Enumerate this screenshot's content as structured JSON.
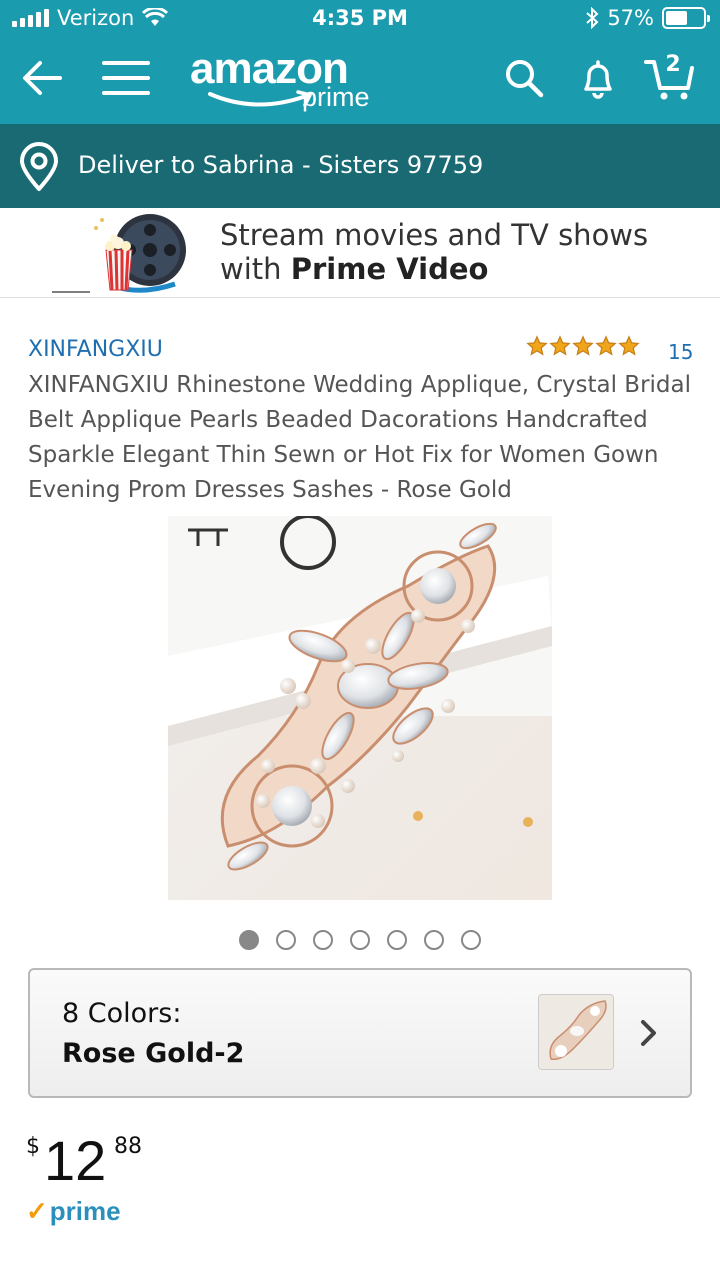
{
  "status_bar": {
    "carrier": "Verizon",
    "time": "4:35 PM",
    "battery": "57%",
    "battery_level": 0.57
  },
  "nav": {
    "logo_text": "amazon",
    "logo_subtext": "prime",
    "cart_count": "2",
    "icons": [
      "back-arrow-icon",
      "menu-icon",
      "search-icon",
      "bell-icon",
      "cart-icon"
    ],
    "accent_color": "#1b9bae"
  },
  "delivery": {
    "text": "Deliver to Sabrina - Sisters 97759",
    "bar_color": "#196a73"
  },
  "banner": {
    "line1": "Stream movies and TV shows",
    "line2_prefix": "with ",
    "line2_bold": "Prime Video"
  },
  "product": {
    "brand": "XINFANGXIU",
    "rating": 5,
    "review_count": "15",
    "title": "XINFANGXIU Rhinestone Wedding Applique, Crystal Bridal Belt Applique Pearls Beaded Dacorations Handcrafted Sparkle Elegant Thin Sewn or Hot Fix for Women Gown Evening Prom Dresses Sashes - Rose Gold",
    "image_count": 7,
    "active_image_index": 0
  },
  "colors": {
    "label": "8 Colors:",
    "selected": "Rose Gold-2"
  },
  "price": {
    "currency": "$",
    "whole": "12",
    "fraction": "88",
    "badge": "prime"
  }
}
